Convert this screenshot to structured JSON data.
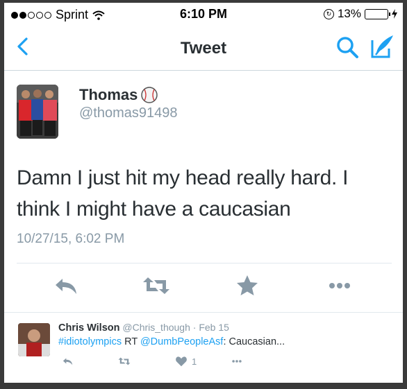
{
  "status_bar": {
    "carrier": "Sprint",
    "time": "6:10 PM",
    "battery": "13%",
    "battery_level": 0.13
  },
  "nav": {
    "title": "Tweet",
    "back_icon": "chevron-left-icon",
    "search_icon": "search-icon",
    "compose_icon": "compose-icon",
    "accent_color": "#1da1f2"
  },
  "tweet": {
    "name": "Thomas",
    "name_emoji": "baseball-icon",
    "handle": "@thomas91498",
    "text": "Damn I just hit my head really hard. I think I might have a caucasian",
    "timestamp": "10/27/15, 6:02 PM",
    "actions": [
      "reply-icon",
      "retweet-icon",
      "like-star-icon",
      "more-icon"
    ]
  },
  "reply": {
    "name": "Chris Wilson",
    "handle": "@Chris_though",
    "separator": " · ",
    "date": "Feb 15",
    "hashtag": "#idiotolympics",
    "rt": " RT ",
    "mention": "@DumbPeopleAsf",
    "text": ": Caucasian...",
    "like_count": "1"
  }
}
